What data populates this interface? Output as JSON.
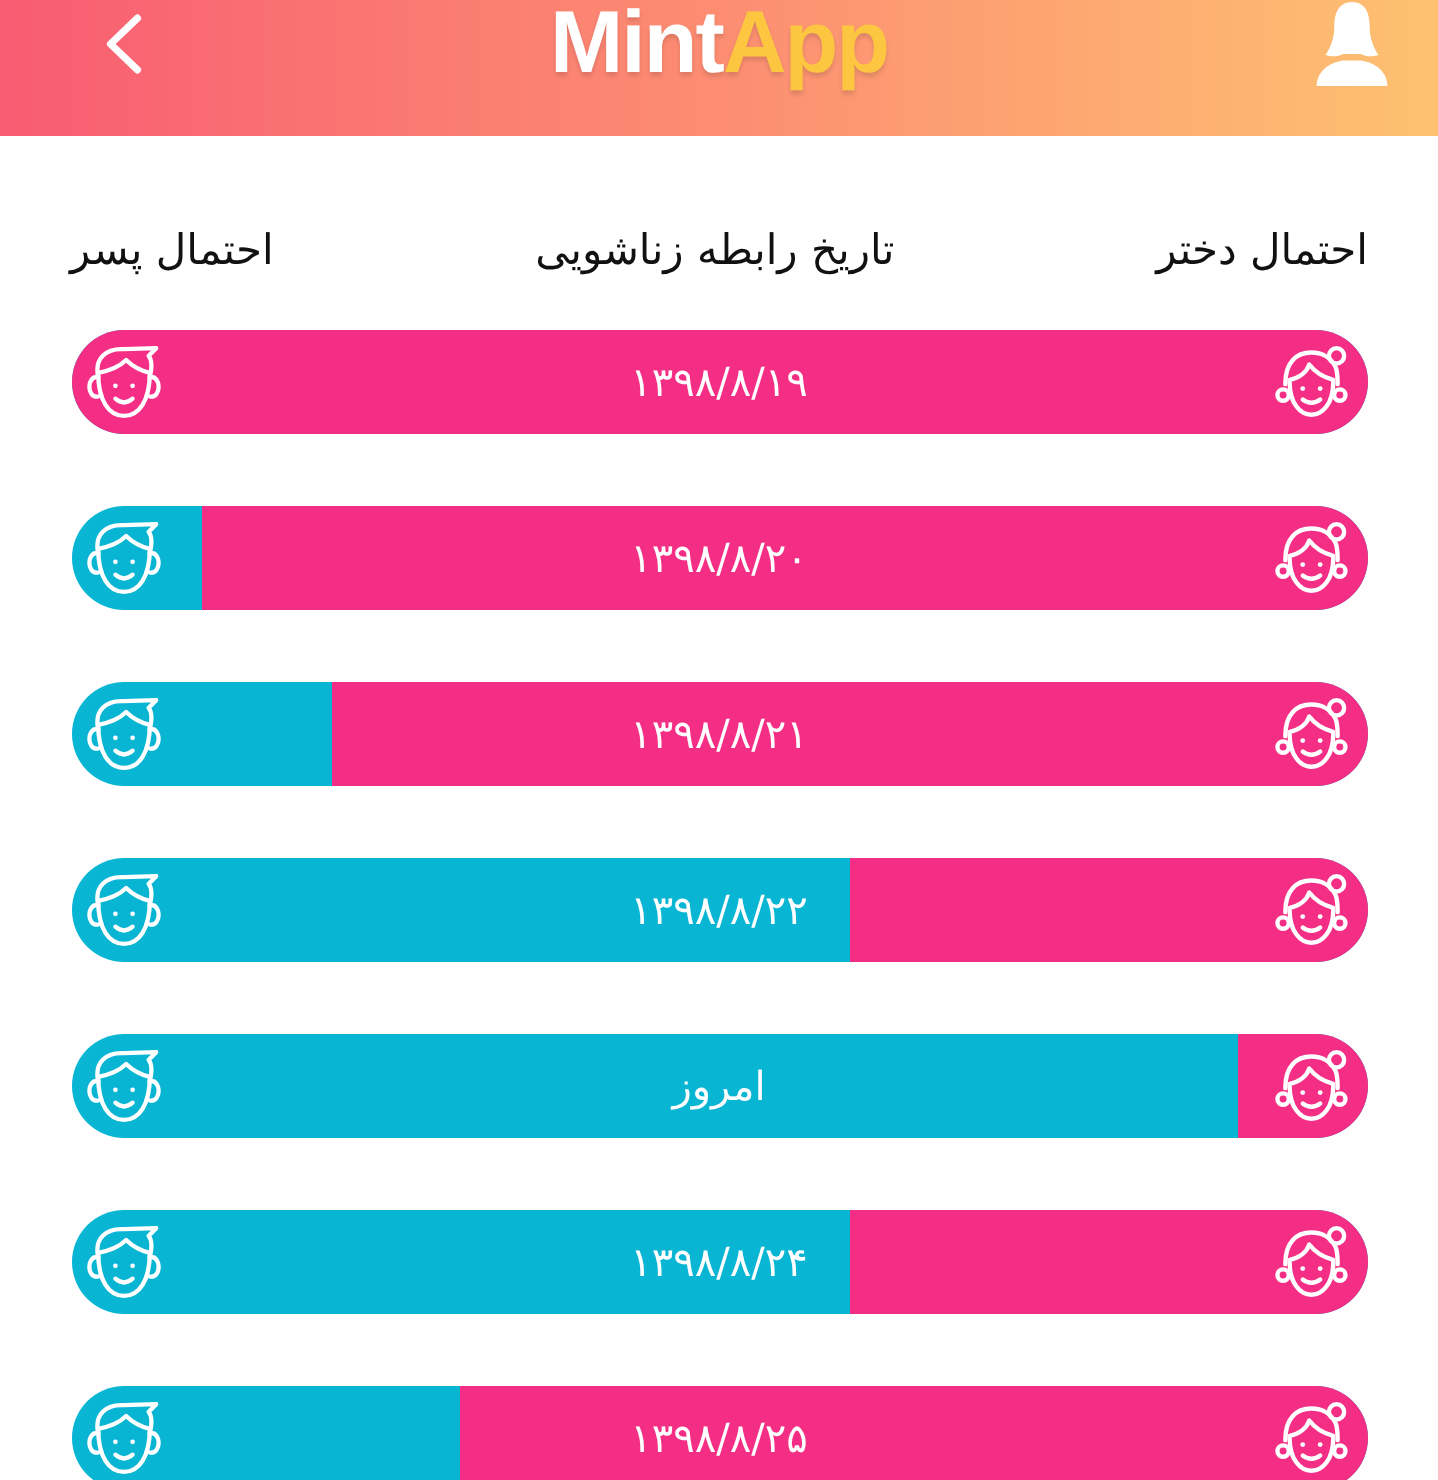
{
  "header": {
    "logo": {
      "part_1": "Mint",
      "part_2": "App"
    }
  },
  "columns": [
    "احتمال دختر",
    "تاریخ رابطه زناشویی",
    "احتمال پسر"
  ],
  "rows": [
    {
      "date": "۱۳۹۸/۸/۱۹",
      "level": 1
    },
    {
      "date": "۱۳۹۸/۸/۲۰",
      "level": 0.9
    },
    {
      "date": "۱۳۹۸/۸/۲۱",
      "level": 0.8
    },
    {
      "date": "۱۳۹۸/۸/۲۲",
      "level": 0.4
    },
    {
      "date": "امروز",
      "level": 0.1
    },
    {
      "date": "۱۳۹۸/۸/۲۴",
      "level": 0.4
    },
    {
      "date": "۱۳۹۸/۸/۲۵",
      "level": 0.7
    }
  ]
}
